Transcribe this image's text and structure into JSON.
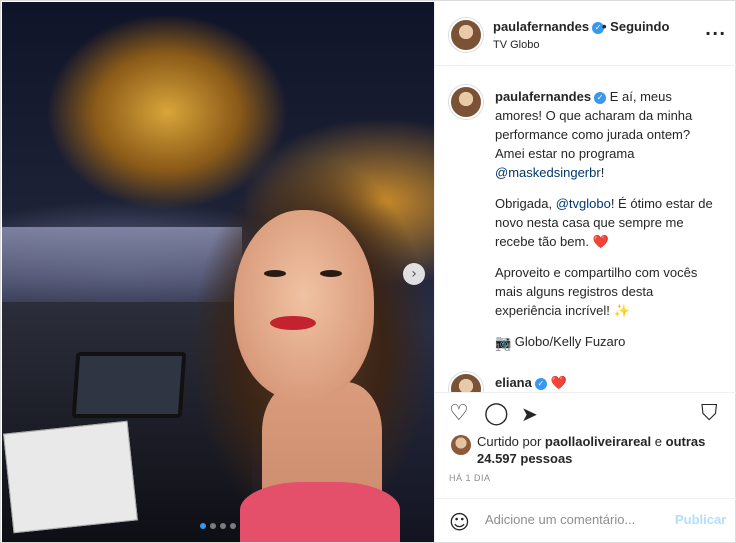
{
  "post": {
    "username": "paulafernandes",
    "follow_status": "• Seguindo",
    "location": "TV Globo",
    "more_icon": "more-horizontal-icon"
  },
  "caption": {
    "username": "paulafernandes",
    "p1_text": "E aí, meus amores! O que acharam da minha performance como jurada ontem? Amei estar no programa ",
    "p1_mention": "@maskedsingerbr",
    "p1_end": "!",
    "p2_start": "Obrigada, ",
    "p2_mention": "@tvglobo",
    "p2_text": "! É ótimo estar de novo nesta casa que sempre me recebe tão bem. ",
    "p2_emoji": "❤️",
    "p3_text": "Aproveito e compartilho com vocês mais alguns registros desta experiência incrível! ",
    "p3_emoji": "✨",
    "p4_emoji": "📷",
    "p4_text": " Globo/Kelly Fuzaro",
    "time": "1 d"
  },
  "comment2": {
    "username": "eliana",
    "emoji": "❤️"
  },
  "likes": {
    "prefix": "Curtido por ",
    "user": "paollaoliveirareal",
    "middle": " e ",
    "others": "outras 24.597 pessoas"
  },
  "timeago": "HÁ 1 DIA",
  "add_comment": {
    "placeholder": "Adicione um comentário...",
    "publish": "Publicar"
  },
  "carousel": {
    "next_glyph": "›",
    "dots": 4,
    "active_index": 0
  },
  "colors": {
    "accent": "#3897f0",
    "heart": "#e0245e",
    "link": "#00376b",
    "publish_disabled": "#b2dffc"
  }
}
